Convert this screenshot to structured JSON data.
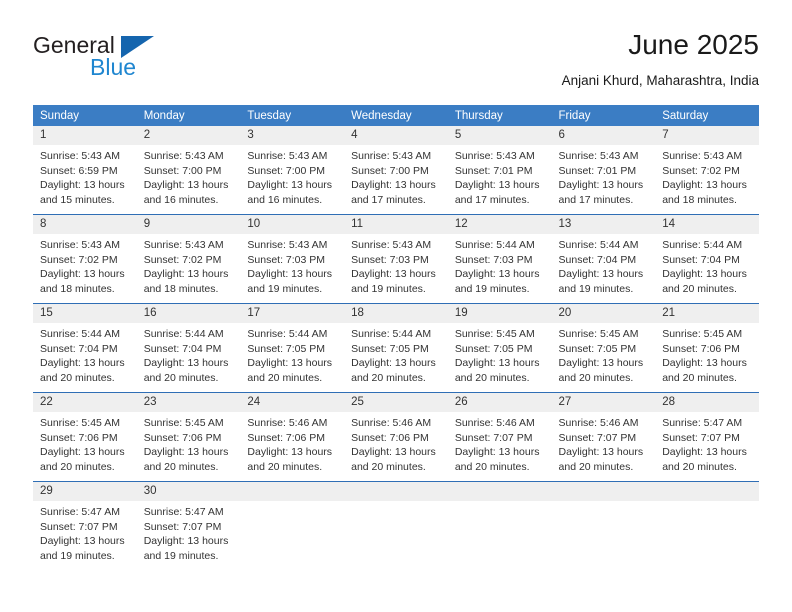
{
  "brand": {
    "name_part1": "General",
    "name_part2": "Blue",
    "triangle_icon": "triangle-icon",
    "accent_dark": "#1565ae",
    "accent_light": "#1f86d0"
  },
  "header": {
    "month_title": "June 2025",
    "location": "Anjani Khurd, Maharashtra, India"
  },
  "theme": {
    "header_row_bg": "#3b7dc4",
    "daynum_bg": "#efefef",
    "row_divider": "#2f6eb5",
    "text": "#333333"
  },
  "calendar": {
    "weekday_headers": [
      "Sunday",
      "Monday",
      "Tuesday",
      "Wednesday",
      "Thursday",
      "Friday",
      "Saturday"
    ],
    "weeks": [
      [
        {
          "day": "1",
          "sunrise": "Sunrise: 5:43 AM",
          "sunset": "Sunset: 6:59 PM",
          "daylight_line1": "Daylight: 13 hours",
          "daylight_line2": "and 15 minutes."
        },
        {
          "day": "2",
          "sunrise": "Sunrise: 5:43 AM",
          "sunset": "Sunset: 7:00 PM",
          "daylight_line1": "Daylight: 13 hours",
          "daylight_line2": "and 16 minutes."
        },
        {
          "day": "3",
          "sunrise": "Sunrise: 5:43 AM",
          "sunset": "Sunset: 7:00 PM",
          "daylight_line1": "Daylight: 13 hours",
          "daylight_line2": "and 16 minutes."
        },
        {
          "day": "4",
          "sunrise": "Sunrise: 5:43 AM",
          "sunset": "Sunset: 7:00 PM",
          "daylight_line1": "Daylight: 13 hours",
          "daylight_line2": "and 17 minutes."
        },
        {
          "day": "5",
          "sunrise": "Sunrise: 5:43 AM",
          "sunset": "Sunset: 7:01 PM",
          "daylight_line1": "Daylight: 13 hours",
          "daylight_line2": "and 17 minutes."
        },
        {
          "day": "6",
          "sunrise": "Sunrise: 5:43 AM",
          "sunset": "Sunset: 7:01 PM",
          "daylight_line1": "Daylight: 13 hours",
          "daylight_line2": "and 17 minutes."
        },
        {
          "day": "7",
          "sunrise": "Sunrise: 5:43 AM",
          "sunset": "Sunset: 7:02 PM",
          "daylight_line1": "Daylight: 13 hours",
          "daylight_line2": "and 18 minutes."
        }
      ],
      [
        {
          "day": "8",
          "sunrise": "Sunrise: 5:43 AM",
          "sunset": "Sunset: 7:02 PM",
          "daylight_line1": "Daylight: 13 hours",
          "daylight_line2": "and 18 minutes."
        },
        {
          "day": "9",
          "sunrise": "Sunrise: 5:43 AM",
          "sunset": "Sunset: 7:02 PM",
          "daylight_line1": "Daylight: 13 hours",
          "daylight_line2": "and 18 minutes."
        },
        {
          "day": "10",
          "sunrise": "Sunrise: 5:43 AM",
          "sunset": "Sunset: 7:03 PM",
          "daylight_line1": "Daylight: 13 hours",
          "daylight_line2": "and 19 minutes."
        },
        {
          "day": "11",
          "sunrise": "Sunrise: 5:43 AM",
          "sunset": "Sunset: 7:03 PM",
          "daylight_line1": "Daylight: 13 hours",
          "daylight_line2": "and 19 minutes."
        },
        {
          "day": "12",
          "sunrise": "Sunrise: 5:44 AM",
          "sunset": "Sunset: 7:03 PM",
          "daylight_line1": "Daylight: 13 hours",
          "daylight_line2": "and 19 minutes."
        },
        {
          "day": "13",
          "sunrise": "Sunrise: 5:44 AM",
          "sunset": "Sunset: 7:04 PM",
          "daylight_line1": "Daylight: 13 hours",
          "daylight_line2": "and 19 minutes."
        },
        {
          "day": "14",
          "sunrise": "Sunrise: 5:44 AM",
          "sunset": "Sunset: 7:04 PM",
          "daylight_line1": "Daylight: 13 hours",
          "daylight_line2": "and 20 minutes."
        }
      ],
      [
        {
          "day": "15",
          "sunrise": "Sunrise: 5:44 AM",
          "sunset": "Sunset: 7:04 PM",
          "daylight_line1": "Daylight: 13 hours",
          "daylight_line2": "and 20 minutes."
        },
        {
          "day": "16",
          "sunrise": "Sunrise: 5:44 AM",
          "sunset": "Sunset: 7:04 PM",
          "daylight_line1": "Daylight: 13 hours",
          "daylight_line2": "and 20 minutes."
        },
        {
          "day": "17",
          "sunrise": "Sunrise: 5:44 AM",
          "sunset": "Sunset: 7:05 PM",
          "daylight_line1": "Daylight: 13 hours",
          "daylight_line2": "and 20 minutes."
        },
        {
          "day": "18",
          "sunrise": "Sunrise: 5:44 AM",
          "sunset": "Sunset: 7:05 PM",
          "daylight_line1": "Daylight: 13 hours",
          "daylight_line2": "and 20 minutes."
        },
        {
          "day": "19",
          "sunrise": "Sunrise: 5:45 AM",
          "sunset": "Sunset: 7:05 PM",
          "daylight_line1": "Daylight: 13 hours",
          "daylight_line2": "and 20 minutes."
        },
        {
          "day": "20",
          "sunrise": "Sunrise: 5:45 AM",
          "sunset": "Sunset: 7:05 PM",
          "daylight_line1": "Daylight: 13 hours",
          "daylight_line2": "and 20 minutes."
        },
        {
          "day": "21",
          "sunrise": "Sunrise: 5:45 AM",
          "sunset": "Sunset: 7:06 PM",
          "daylight_line1": "Daylight: 13 hours",
          "daylight_line2": "and 20 minutes."
        }
      ],
      [
        {
          "day": "22",
          "sunrise": "Sunrise: 5:45 AM",
          "sunset": "Sunset: 7:06 PM",
          "daylight_line1": "Daylight: 13 hours",
          "daylight_line2": "and 20 minutes."
        },
        {
          "day": "23",
          "sunrise": "Sunrise: 5:45 AM",
          "sunset": "Sunset: 7:06 PM",
          "daylight_line1": "Daylight: 13 hours",
          "daylight_line2": "and 20 minutes."
        },
        {
          "day": "24",
          "sunrise": "Sunrise: 5:46 AM",
          "sunset": "Sunset: 7:06 PM",
          "daylight_line1": "Daylight: 13 hours",
          "daylight_line2": "and 20 minutes."
        },
        {
          "day": "25",
          "sunrise": "Sunrise: 5:46 AM",
          "sunset": "Sunset: 7:06 PM",
          "daylight_line1": "Daylight: 13 hours",
          "daylight_line2": "and 20 minutes."
        },
        {
          "day": "26",
          "sunrise": "Sunrise: 5:46 AM",
          "sunset": "Sunset: 7:07 PM",
          "daylight_line1": "Daylight: 13 hours",
          "daylight_line2": "and 20 minutes."
        },
        {
          "day": "27",
          "sunrise": "Sunrise: 5:46 AM",
          "sunset": "Sunset: 7:07 PM",
          "daylight_line1": "Daylight: 13 hours",
          "daylight_line2": "and 20 minutes."
        },
        {
          "day": "28",
          "sunrise": "Sunrise: 5:47 AM",
          "sunset": "Sunset: 7:07 PM",
          "daylight_line1": "Daylight: 13 hours",
          "daylight_line2": "and 20 minutes."
        }
      ],
      [
        {
          "day": "29",
          "sunrise": "Sunrise: 5:47 AM",
          "sunset": "Sunset: 7:07 PM",
          "daylight_line1": "Daylight: 13 hours",
          "daylight_line2": "and 19 minutes."
        },
        {
          "day": "30",
          "sunrise": "Sunrise: 5:47 AM",
          "sunset": "Sunset: 7:07 PM",
          "daylight_line1": "Daylight: 13 hours",
          "daylight_line2": "and 19 minutes."
        },
        {
          "day": "",
          "sunrise": "",
          "sunset": "",
          "daylight_line1": "",
          "daylight_line2": ""
        },
        {
          "day": "",
          "sunrise": "",
          "sunset": "",
          "daylight_line1": "",
          "daylight_line2": ""
        },
        {
          "day": "",
          "sunrise": "",
          "sunset": "",
          "daylight_line1": "",
          "daylight_line2": ""
        },
        {
          "day": "",
          "sunrise": "",
          "sunset": "",
          "daylight_line1": "",
          "daylight_line2": ""
        },
        {
          "day": "",
          "sunrise": "",
          "sunset": "",
          "daylight_line1": "",
          "daylight_line2": ""
        }
      ]
    ]
  }
}
